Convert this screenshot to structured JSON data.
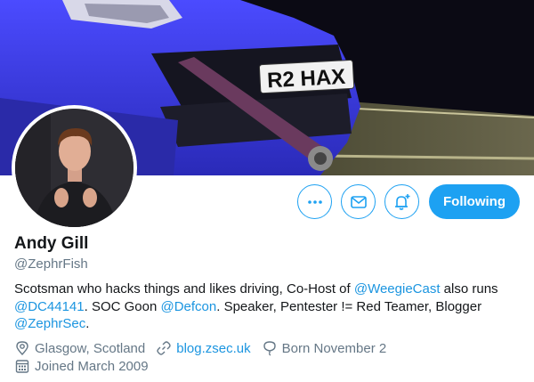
{
  "banner": {
    "plate_text": "R2 HAX",
    "colors": {
      "car": "#3a3ae8",
      "background": "#0b0a14",
      "strap": "#6a3a5e"
    }
  },
  "avatar": {
    "description_icon": "profile-photo"
  },
  "actions": {
    "more_icon": "more-dots-icon",
    "message_icon": "envelope-icon",
    "notify_icon": "bell-plus-icon",
    "follow_label": "Following"
  },
  "profile": {
    "name": "Andy Gill",
    "handle": "@ZephrFish"
  },
  "bio": {
    "t1": "Scotsman who hacks things and likes driving, Co-Host of ",
    "m1": "@WeegieCast",
    "t2": " also runs ",
    "m2": "@DC44141",
    "t3": ". SOC Goon ",
    "m3": "@Defcon",
    "t4": ". Speaker, Pentester != Red Teamer, Blogger ",
    "m4": "@ZephrSec",
    "t5": "."
  },
  "meta": {
    "location": "Glasgow, Scotland",
    "website": "blog.zsec.uk",
    "born": "Born November 2",
    "joined": "Joined March 2009"
  },
  "colors": {
    "accent": "#1da1f2",
    "link": "#1b95e0",
    "secondary_text": "#657786"
  }
}
